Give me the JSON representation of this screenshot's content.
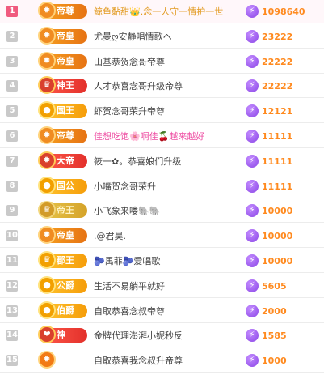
{
  "colors": {
    "score": "#ff8a1f",
    "rank_top": "#f05a7e",
    "bolt": "#8b46e6"
  },
  "rows": [
    {
      "rank": "1",
      "badge": "帝尊",
      "badge_icon": "fire-icon",
      "badge_style": "orange",
      "name": "鲸鱼黏甜👑.念一人守一情护一世",
      "name_style": "gold",
      "score": "1098640"
    },
    {
      "rank": "2",
      "badge": "帝皇",
      "badge_icon": "fire-icon",
      "badge_style": "orange",
      "name": "尤曼ღ安静唱情歌ヘ",
      "name_style": "",
      "score": "23222"
    },
    {
      "rank": "3",
      "badge": "帝皇",
      "badge_icon": "fire-icon",
      "badge_style": "orange",
      "name": "山基恭贺念哥帝尊",
      "name_style": "",
      "score": "22222"
    },
    {
      "rank": "4",
      "badge": "神王",
      "badge_icon": "crest-icon",
      "badge_style": "red",
      "name": "人才恭喜念哥升级帝尊",
      "name_style": "",
      "score": "22222"
    },
    {
      "rank": "5",
      "badge": "国王",
      "badge_icon": "coin-icon",
      "badge_style": "gold",
      "name": "虾贺念哥荣升帝尊",
      "name_style": "",
      "score": "12121"
    },
    {
      "rank": "6",
      "badge": "帝尊",
      "badge_icon": "fire-icon",
      "badge_style": "orange",
      "name": "佳想吃饱🌸啊佳🍒越来越好",
      "name_style": "pink",
      "score": "11111"
    },
    {
      "rank": "7",
      "badge": "大帝",
      "badge_icon": "fire-icon",
      "badge_style": "red",
      "name": "筱一✿。恭喜娘们升级",
      "name_style": "",
      "score": "11111"
    },
    {
      "rank": "8",
      "badge": "国公",
      "badge_icon": "coin-icon",
      "badge_style": "gold",
      "name": "小嘴贺念哥荣升",
      "name_style": "",
      "score": "11111"
    },
    {
      "rank": "9",
      "badge": "帝王",
      "badge_icon": "crest-icon",
      "badge_style": "dim",
      "name": "小飞象来喽🐘🐘",
      "name_style": "",
      "score": "10000"
    },
    {
      "rank": "10",
      "badge": "帝皇",
      "badge_icon": "fire-icon",
      "badge_style": "orange",
      "name": ".@君昊.",
      "name_style": "",
      "score": "10000"
    },
    {
      "rank": "11",
      "badge": "郡王",
      "badge_icon": "crest-icon",
      "badge_style": "gold",
      "name": "🫐禹菲🫐爱唱歌",
      "name_style": "",
      "score": "10000"
    },
    {
      "rank": "12",
      "badge": "公爵",
      "badge_icon": "coin-icon",
      "badge_style": "gold",
      "name": "生活不易躺平就好",
      "name_style": "",
      "score": "5605"
    },
    {
      "rank": "13",
      "badge": "伯爵",
      "badge_icon": "coin-icon",
      "badge_style": "gold",
      "name": "自取恭喜念叔帝尊",
      "name_style": "",
      "score": "2000"
    },
    {
      "rank": "14",
      "badge": "神",
      "badge_icon": "heart-icon",
      "badge_style": "red",
      "name": "金牌代理澎湃小妮秒反",
      "name_style": "",
      "score": "1585"
    },
    {
      "rank": "15",
      "badge": "",
      "badge_icon": "fire-icon",
      "badge_style": "blank",
      "name": "自取恭喜我念叔升帝尊",
      "name_style": "",
      "score": "1000"
    }
  ]
}
